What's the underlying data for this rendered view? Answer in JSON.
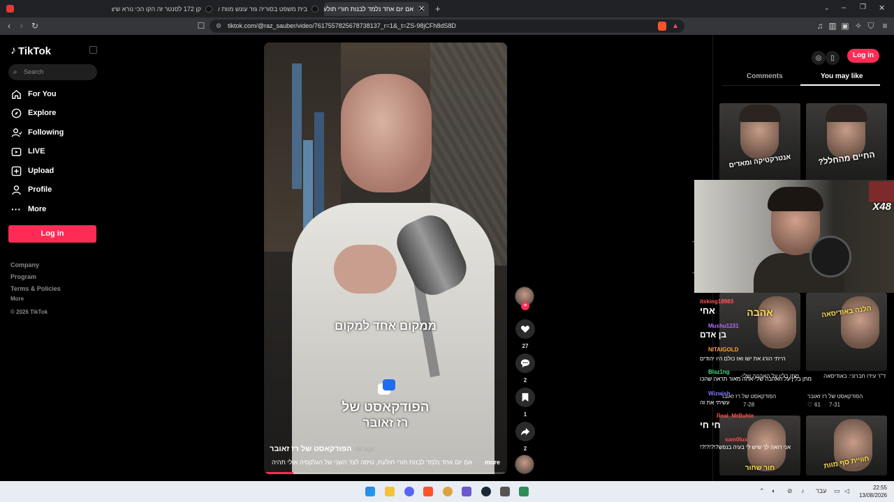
{
  "browser": {
    "tabs": [
      {
        "title": "קן 172 לסנטר זה הקו הכי נורא שיצר:"
      },
      {
        "title": "בית משפט בסוריה גזר עונש מוות של:"
      },
      {
        "title": "אם יום אחד נלמד לבנות חורי תולעת"
      }
    ],
    "url": "tiktok.com/@raz_sauber/video/7617557825678738137_r=1&_t=ZS-98jCFh8dS8D"
  },
  "sidebar": {
    "logo": "TikTok",
    "search_placeholder": "Search",
    "menu": [
      {
        "label": "For You",
        "icon": "home-icon"
      },
      {
        "label": "Explore",
        "icon": "compass-icon"
      },
      {
        "label": "Following",
        "icon": "following-icon"
      },
      {
        "label": "LIVE",
        "icon": "live-icon"
      },
      {
        "label": "Upload",
        "icon": "upload-icon"
      },
      {
        "label": "Profile",
        "icon": "profile-icon"
      },
      {
        "label": "More",
        "icon": "more-icon"
      }
    ],
    "login_label": "Log in",
    "footer": {
      "company": "Company",
      "program": "Program",
      "terms": "Terms & Policies",
      "more": "More",
      "copyright": "© 2026 TikTok"
    }
  },
  "video": {
    "caption_top": "ממקום אחד למקום",
    "caption_line1": "הפודקאסט של",
    "caption_line2": "רז זאובר",
    "author": "הפודקאסט של רז זאובר",
    "date": "· 4d ago",
    "description": "אם יום אחד נלמד לבנות חורי תולעת, טיסה לצד השני של הגלקסיה אולי תהיה",
    "more_label": "more",
    "progress": 0.12
  },
  "actions": {
    "likes": "27",
    "comments": "2",
    "saves": "1",
    "shares": "2"
  },
  "right_panel": {
    "login_label": "Log in",
    "tab_comments": "Comments",
    "tab_you_may_like": "You may like",
    "thumbs": [
      {
        "label": "אנטרקטיקה ומאדים"
      },
      {
        "label": "החיים מהחלל?"
      },
      {
        "label": "אהבה"
      },
      {
        "label": "הלנה באודיסאה"
      },
      {
        "label": "חור שחור"
      },
      {
        "label": "חוויית סף מוות"
      }
    ],
    "item_titles": [
      {
        "text": "מתן בלין על האהבה שלי-..."
      },
      {
        "text": "ד\"ר עידו חברוני: באודיסאה"
      }
    ],
    "item_authors": [
      {
        "text": "הפודקאסט של רז זאובר"
      },
      {
        "text": "הפודקאסט של רז זאובר"
      }
    ],
    "item_stats": [
      {
        "likes": "",
        "date": "7-28"
      },
      {
        "likes": "61",
        "date": "7-31"
      }
    ]
  },
  "stream_overlay": {
    "multiplier": "X48",
    "chat": [
      {
        "user": "itsking18983",
        "message": "אחי",
        "color": "#ff5a5a"
      },
      {
        "user": "Mushu1231",
        "message": "בן אדם",
        "color": "#b86bff"
      },
      {
        "user": "NITAIGOLD",
        "message": "הייתי הורג את ישו ואז כולם היו יהודים",
        "color": "#ff9b3d"
      },
      {
        "user": "Blaz1ng",
        "message": "מתן בלין על האהבה שלי-אתה מאור תראה שהכרשים אמורים לבוא לפה",
        "color": "#3ddc84"
      },
      {
        "user": "Wizwish",
        "message": "עשיתי את זה",
        "color": "#7a7aff"
      },
      {
        "user": "Real_MrBuhle",
        "message": "חי חי",
        "color": "#ff4d4d"
      },
      {
        "user": "sam0lux",
        "message": "אני רואה לך שיש לי בעיה בנפש?!?!?!?!",
        "color": "#ff4d4d"
      }
    ]
  },
  "taskbar": {
    "time": "22:55",
    "date": "13/08/2026",
    "lang": "עבר"
  },
  "colors": {
    "accent": "#fe2c55",
    "background": "#000000"
  }
}
